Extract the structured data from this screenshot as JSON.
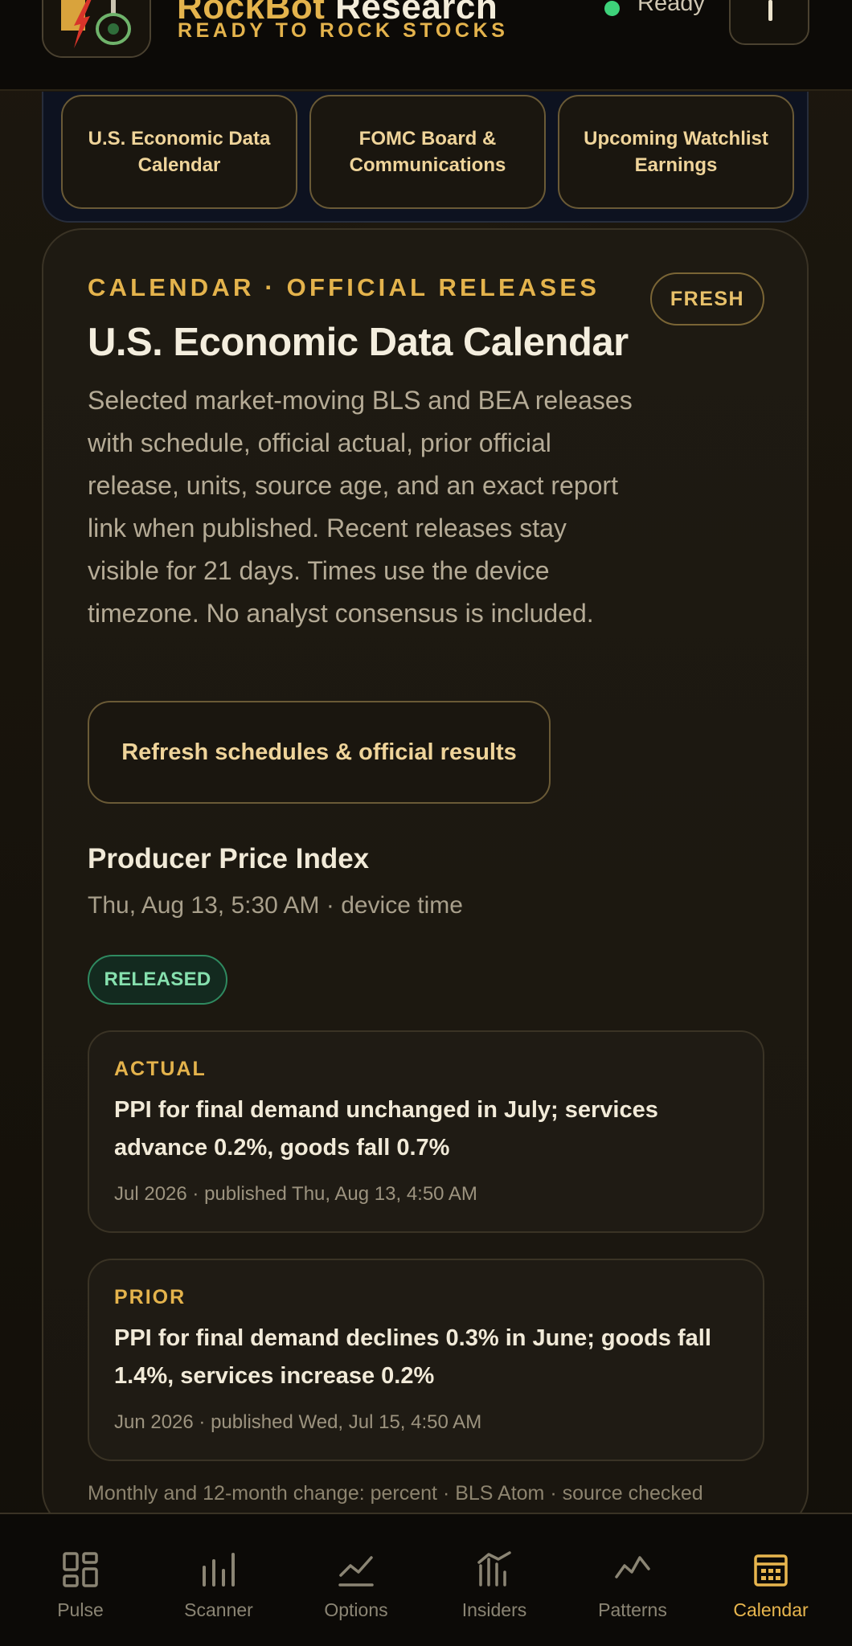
{
  "header": {
    "brand_first": "RockBot",
    "brand_second": "Research",
    "tagline": "READY TO ROCK STOCKS",
    "status": "Ready",
    "status_color": "#3ed27a"
  },
  "shortcuts": [
    {
      "label": "U.S. Economic Data Calendar"
    },
    {
      "label": "FOMC Board & Communications"
    },
    {
      "label": "Upcoming Watchlist Earnings"
    }
  ],
  "card": {
    "eyebrow": "CALENDAR · OFFICIAL RELEASES",
    "badge": "FRESH",
    "title": "U.S. Economic Data Calendar",
    "description": "Selected market-moving BLS and BEA releases with schedule, official actual, prior official release, units, source age, and an exact report link when published. Recent releases stay visible for 21 days. Times use the device timezone. No analyst consensus is included.",
    "refresh_label": "Refresh schedules & official results"
  },
  "release": {
    "name": "Producer Price Index",
    "time": "Thu, Aug 13, 5:30 AM · device time",
    "status": "RELEASED",
    "actual": {
      "label": "ACTUAL",
      "headline": "PPI for final demand unchanged in July; services advance 0.2%, goods fall 0.7%",
      "meta": "Jul 2026 · published Thu, Aug 13, 4:50 AM"
    },
    "prior": {
      "label": "PRIOR",
      "headline": "PPI for final demand declines 0.3% in June; goods fall 1.4%, services increase 0.2%",
      "meta": "Jun 2026 · published Wed, Jul 15, 4:50 AM"
    },
    "footnote": "Monthly and 12-month change: percent · BLS Atom · source checked"
  },
  "nav": [
    {
      "label": "Pulse",
      "icon": "pulse-grid-icon"
    },
    {
      "label": "Scanner",
      "icon": "scanner-bars-icon"
    },
    {
      "label": "Options",
      "icon": "options-line-icon"
    },
    {
      "label": "Insiders",
      "icon": "insiders-chart-icon"
    },
    {
      "label": "Patterns",
      "icon": "patterns-zigzag-icon"
    },
    {
      "label": "Calendar",
      "icon": "calendar-icon",
      "active": true
    }
  ],
  "colors": {
    "accent": "#e4b34c",
    "background": "#17130c",
    "released_green": "#86e0ae"
  }
}
